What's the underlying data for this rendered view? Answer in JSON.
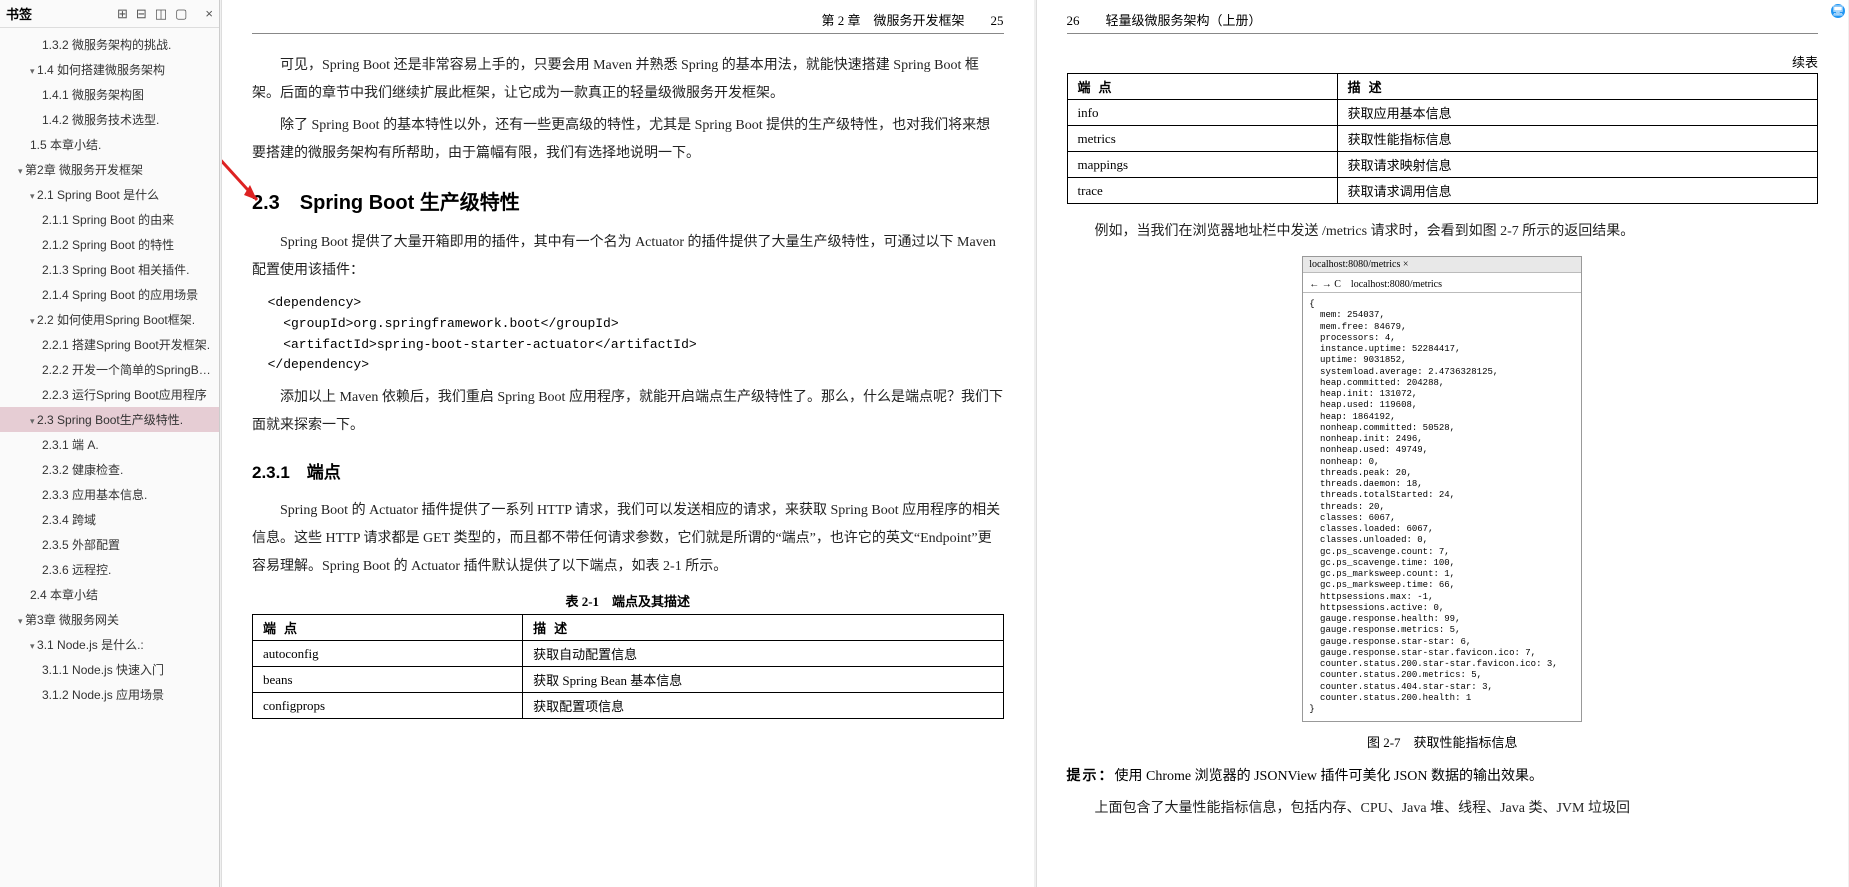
{
  "sidebar": {
    "title": "书签",
    "close": "×",
    "items": [
      {
        "lv": 3,
        "label": "1.3.2 微服务架构的挑战."
      },
      {
        "lv": 2,
        "label": "1.4 如何搭建微服务架构",
        "tri": "open"
      },
      {
        "lv": 3,
        "label": "1.4.1 微服务架构图"
      },
      {
        "lv": 3,
        "label": "1.4.2 微服务技术选型."
      },
      {
        "lv": 2,
        "label": "1.5 本章小结."
      },
      {
        "lv": 1,
        "label": "第2章 微服务开发框架",
        "tri": "open"
      },
      {
        "lv": 2,
        "label": "2.1 Spring Boot 是什么",
        "tri": "open"
      },
      {
        "lv": 3,
        "label": "2.1.1 Spring Boot 的由来"
      },
      {
        "lv": 3,
        "label": "2.1.2 Spring Boot 的特性"
      },
      {
        "lv": 3,
        "label": "2.1.3 Spring Boot 相关插件."
      },
      {
        "lv": 3,
        "label": "2.1.4 Spring Boot 的应用场景"
      },
      {
        "lv": 2,
        "label": "2.2 如何使用Spring Boot框架.",
        "tri": "open"
      },
      {
        "lv": 3,
        "label": "2.2.1 搭建Spring Boot开发框架."
      },
      {
        "lv": 3,
        "label": "2.2.2 开发一个简单的SpringBo…"
      },
      {
        "lv": 3,
        "label": "2.2.3 运行Spring Boot应用程序"
      },
      {
        "lv": 2,
        "label": "2.3 Spring Boot生产级特性.",
        "sel": true,
        "tri": "open"
      },
      {
        "lv": 3,
        "label": "2.3.1 端 A."
      },
      {
        "lv": 3,
        "label": "2.3.2 健康检查."
      },
      {
        "lv": 3,
        "label": "2.3.3 应用基本信息."
      },
      {
        "lv": 3,
        "label": "2.3.4 跨域"
      },
      {
        "lv": 3,
        "label": "2.3.5 外部配置"
      },
      {
        "lv": 3,
        "label": "2.3.6 远程控."
      },
      {
        "lv": 2,
        "label": "2.4 本章小结"
      },
      {
        "lv": 1,
        "label": "第3章 微服务网关",
        "tri": "open"
      },
      {
        "lv": 2,
        "label": "3.1 Node.js 是什么.:",
        "tri": "open"
      },
      {
        "lv": 3,
        "label": "3.1.1 Node.js 快速入门"
      },
      {
        "lv": 3,
        "label": "3.1.2 Node.js 应用场景"
      }
    ]
  },
  "pageL": {
    "header": "第 2 章　微服务开发框架　　25",
    "p1": "可见，Spring Boot 还是非常容易上手的，只要会用 Maven 并熟悉 Spring 的基本用法，就能快速搭建 Spring Boot 框架。后面的章节中我们继续扩展此框架，让它成为一款真正的轻量级微服务开发框架。",
    "p2": "除了 Spring Boot 的基本特性以外，还有一些更高级的特性，尤其是 Spring Boot 提供的生产级特性，也对我们将来想要搭建的微服务架构有所帮助，由于篇幅有限，我们有选择地说明一下。",
    "h2": "2.3　Spring Boot 生产级特性",
    "p3": "Spring Boot 提供了大量开箱即用的插件，其中有一个名为 Actuator 的插件提供了大量生产级特性，可通过以下 Maven 配置使用该插件：",
    "code": "  <dependency>\n    <groupId>org.springframework.boot</groupId>\n    <artifactId>spring-boot-starter-actuator</artifactId>\n  </dependency>",
    "p4": "添加以上 Maven 依赖后，我们重启 Spring Boot 应用程序，就能开启端点生产级特性了。那么，什么是端点呢？我们下面就来探索一下。",
    "h3": "2.3.1　端点",
    "p5": "Spring Boot 的 Actuator 插件提供了一系列 HTTP 请求，我们可以发送相应的请求，来获取 Spring Boot 应用程序的相关信息。这些 HTTP 请求都是 GET 类型的，而且都不带任何请求参数，它们就是所谓的“端点”，也许它的英文“Endpoint”更容易理解。Spring Boot 的 Actuator 插件默认提供了以下端点，如表 2-1 所示。",
    "tblcap": "表 2-1　端点及其描述",
    "th1": "端点",
    "th2": "描述",
    "rows": [
      [
        "autoconfig",
        "获取自动配置信息"
      ],
      [
        "beans",
        "获取 Spring Bean 基本信息"
      ],
      [
        "configprops",
        "获取配置项信息"
      ]
    ]
  },
  "pageR": {
    "header": "26　　轻量级微服务架构（上册）",
    "cont": "续表",
    "th1": "端点",
    "th2": "描述",
    "rows": [
      [
        "info",
        "获取应用基本信息"
      ],
      [
        "metrics",
        "获取性能指标信息"
      ],
      [
        "mappings",
        "获取请求映射信息"
      ],
      [
        "trace",
        "获取请求调用信息"
      ]
    ],
    "p1": "例如，当我们在浏览器地址栏中发送 /metrics 请求时，会看到如图 2-7 所示的返回结果。",
    "fig": {
      "tab": "localhost:8080/metrics ×",
      "url": "← → C　localhost:8080/metrics",
      "body": "{\n  mem: 254037,\n  mem.free: 84679,\n  processors: 4,\n  instance.uptime: 52284417,\n  uptime: 9031852,\n  systemload.average: 2.4736328125,\n  heap.committed: 204288,\n  heap.init: 131072,\n  heap.used: 119608,\n  heap: 1864192,\n  nonheap.committed: 50528,\n  nonheap.init: 2496,\n  nonheap.used: 49749,\n  nonheap: 0,\n  threads.peak: 20,\n  threads.daemon: 18,\n  threads.totalStarted: 24,\n  threads: 20,\n  classes: 6067,\n  classes.loaded: 6067,\n  classes.unloaded: 0,\n  gc.ps_scavenge.count: 7,\n  gc.ps_scavenge.time: 100,\n  gc.ps_marksweep.count: 1,\n  gc.ps_marksweep.time: 66,\n  httpsessions.max: -1,\n  httpsessions.active: 0,\n  gauge.response.health: 99,\n  gauge.response.metrics: 5,\n  gauge.response.star-star: 6,\n  gauge.response.star-star.favicon.ico: 7,\n  counter.status.200.star-star.favicon.ico: 3,\n  counter.status.200.metrics: 5,\n  counter.status.404.star-star: 3,\n  counter.status.200.health: 1\n}",
      "caption": "图 2-7　获取性能指标信息"
    },
    "tip": "提示：使用 Chrome 浏览器的 JSONView 插件可美化 JSON 数据的输出效果。",
    "p2": "上面包含了大量性能指标信息，包括内存、CPU、Java 堆、线程、Java 类、JVM 垃圾回"
  }
}
